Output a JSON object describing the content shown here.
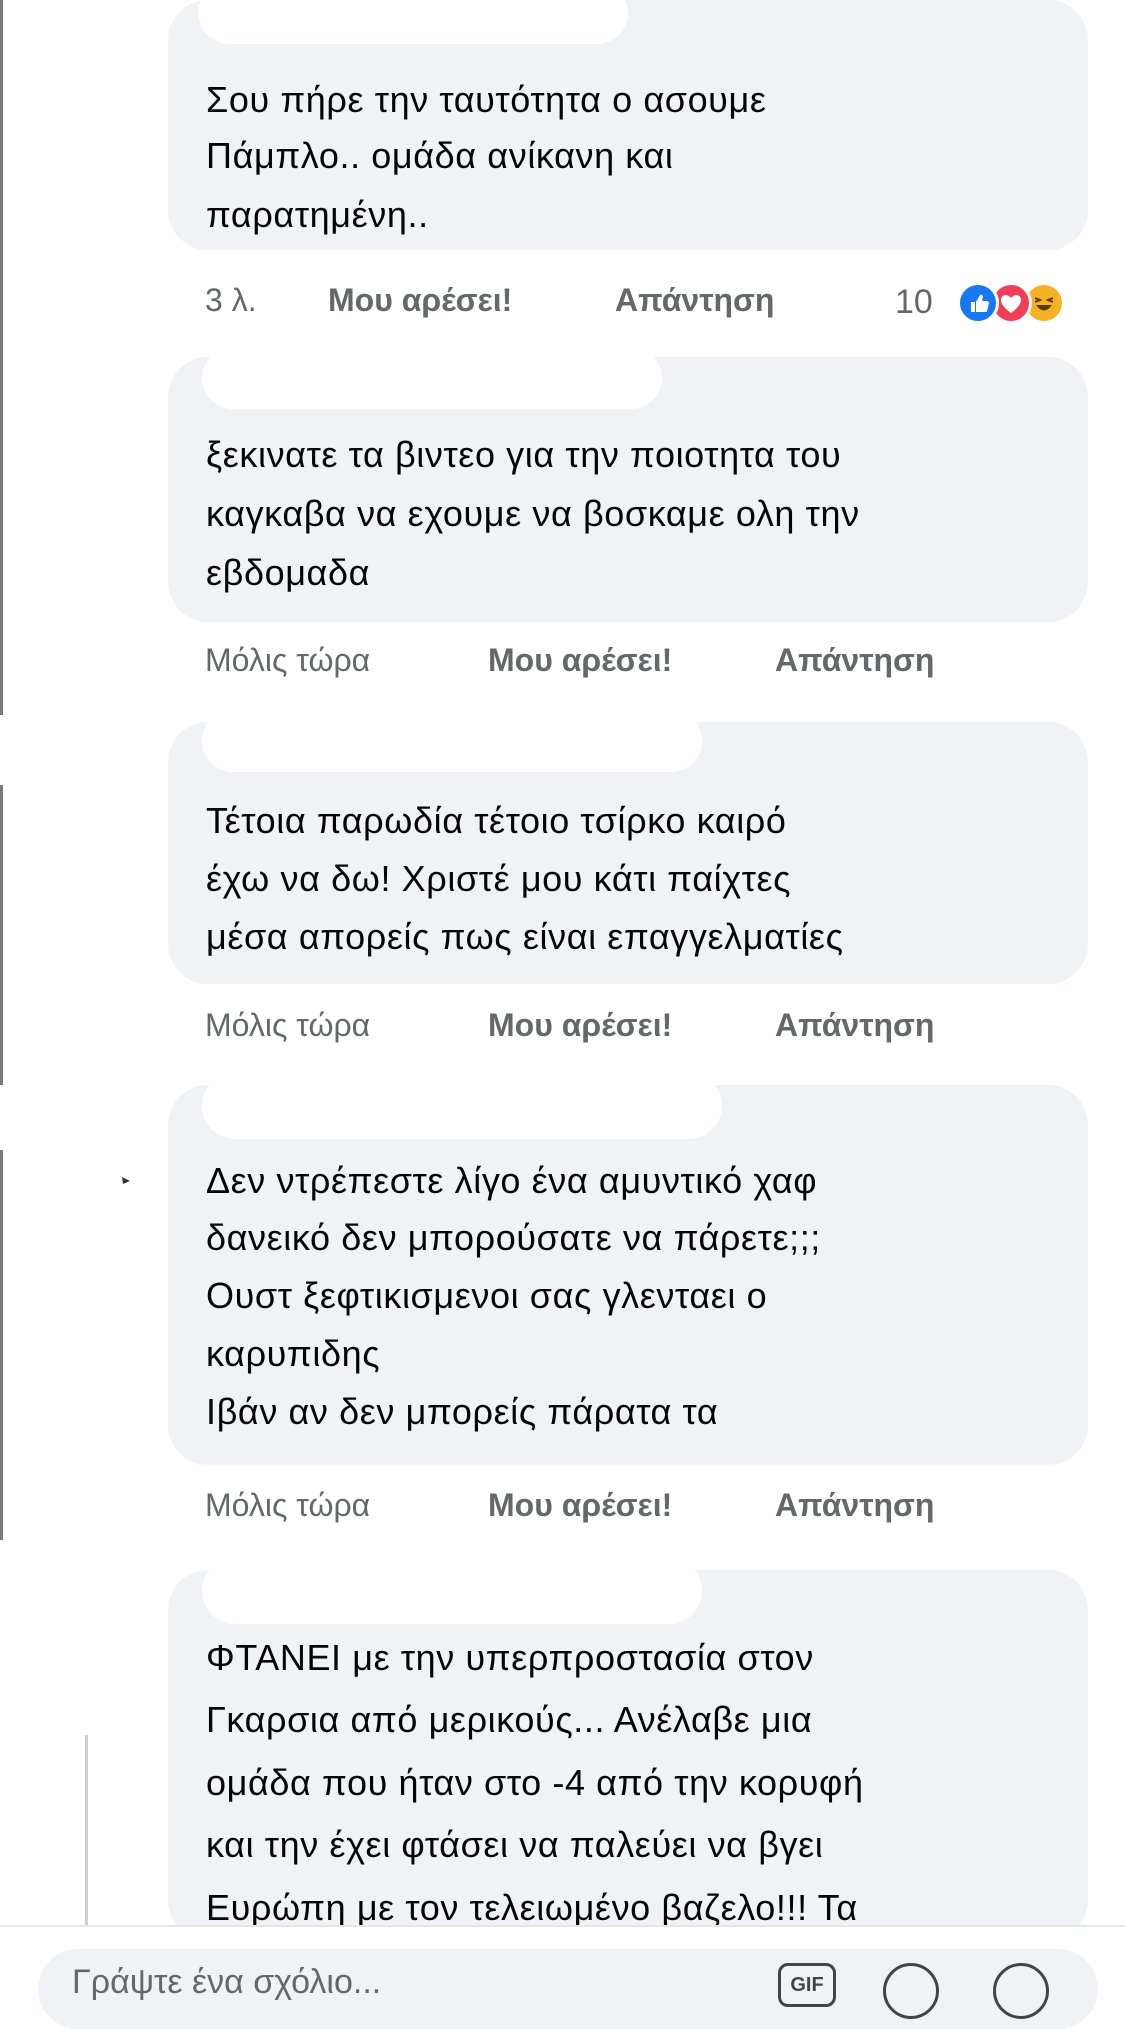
{
  "comments": [
    {
      "lines": [
        "Σου πήρε την ταυτότητα ο ασουμε",
        "Πάμπλο.. ομάδα ανίκανη και",
        "παρατημένη.."
      ],
      "time": "3 λ.",
      "like_label": "Μου αρέσει!",
      "reply_label": "Απάντηση",
      "reaction_count": "10",
      "reactions": [
        "like-icon",
        "love-icon",
        "haha-icon"
      ]
    },
    {
      "lines": [
        "ξεκινατε τα βιντεο για την ποιοτητα του",
        "καγκαβα να εχουμε να βοσκαμε ολη την",
        "εβδομαδα"
      ],
      "time": "Μόλις τώρα",
      "like_label": "Μου αρέσει!",
      "reply_label": "Απάντηση"
    },
    {
      "lines": [
        "Τέτοια παρωδία τέτοιο τσίρκο καιρό",
        "έχω να δω! Χριστέ μου κάτι παίχτες",
        "μέσα απορείς πως είναι επαγγελματίες"
      ],
      "time": "Μόλις τώρα",
      "like_label": "Μου αρέσει!",
      "reply_label": "Απάντηση"
    },
    {
      "lines": [
        "Δεν ντρέπεστε λίγο ένα αμυντικό χαφ",
        "δανεικό δεν μπορούσατε να πάρετε;;;",
        "Ουστ ξεφτικισμενοι σας γλενταει ο",
        "καρυπιδης",
        "Ιβάν αν δεν μπορείς πάρατα τα"
      ],
      "time": "Μόλις τώρα",
      "like_label": "Μου αρέσει!",
      "reply_label": "Απάντηση"
    },
    {
      "lines": [
        "ΦΤΑΝΕΙ με την υπερπροστασία στον",
        "Γκαρσια από μερικούς... Ανέλαβε μια",
        "ομάδα που ήταν στο -4 από την κορυφή",
        "και την έχει φτάσει να παλεύει να βγει",
        "Ευρώπη με τον τελειωμένο βαζελο!!! Τα"
      ]
    }
  ],
  "composer": {
    "placeholder": "Γράψτε ένα σχόλιο...",
    "gif_label": "GIF",
    "icons": [
      "gif-icon",
      "sticker-icon",
      "emoji-icon"
    ]
  },
  "colors": {
    "bubble": "#f0f2f5",
    "meta_text": "#65676b",
    "like_blue": "#1877f2",
    "love_red": "#f33e58",
    "haha_yellow": "#f7b125"
  }
}
